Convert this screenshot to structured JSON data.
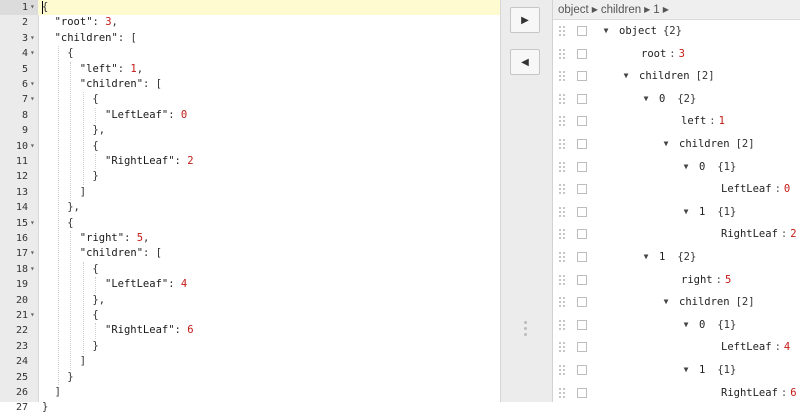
{
  "editor": {
    "lines": [
      {
        "n": "1",
        "fold": true,
        "indent": 0,
        "tokens": [
          {
            "t": "{",
            "c": "pun"
          }
        ]
      },
      {
        "n": "2",
        "fold": false,
        "indent": 1,
        "tokens": [
          {
            "t": "\"root\"",
            "c": "key"
          },
          {
            "t": ": ",
            "c": "pun"
          },
          {
            "t": "3",
            "c": "num"
          },
          {
            "t": ",",
            "c": "pun"
          }
        ]
      },
      {
        "n": "3",
        "fold": true,
        "indent": 1,
        "tokens": [
          {
            "t": "\"children\"",
            "c": "key"
          },
          {
            "t": ": [",
            "c": "pun"
          }
        ]
      },
      {
        "n": "4",
        "fold": true,
        "indent": 2,
        "tokens": [
          {
            "t": "{",
            "c": "pun"
          }
        ]
      },
      {
        "n": "5",
        "fold": false,
        "indent": 3,
        "tokens": [
          {
            "t": "\"left\"",
            "c": "key"
          },
          {
            "t": ": ",
            "c": "pun"
          },
          {
            "t": "1",
            "c": "num"
          },
          {
            "t": ",",
            "c": "pun"
          }
        ]
      },
      {
        "n": "6",
        "fold": true,
        "indent": 3,
        "tokens": [
          {
            "t": "\"children\"",
            "c": "key"
          },
          {
            "t": ": [",
            "c": "pun"
          }
        ]
      },
      {
        "n": "7",
        "fold": true,
        "indent": 4,
        "tokens": [
          {
            "t": "{",
            "c": "pun"
          }
        ]
      },
      {
        "n": "8",
        "fold": false,
        "indent": 5,
        "tokens": [
          {
            "t": "\"LeftLeaf\"",
            "c": "key"
          },
          {
            "t": ": ",
            "c": "pun"
          },
          {
            "t": "0",
            "c": "num"
          }
        ]
      },
      {
        "n": "9",
        "fold": false,
        "indent": 4,
        "tokens": [
          {
            "t": "},",
            "c": "pun"
          }
        ]
      },
      {
        "n": "10",
        "fold": true,
        "indent": 4,
        "tokens": [
          {
            "t": "{",
            "c": "pun"
          }
        ]
      },
      {
        "n": "11",
        "fold": false,
        "indent": 5,
        "tokens": [
          {
            "t": "\"RightLeaf\"",
            "c": "key"
          },
          {
            "t": ": ",
            "c": "pun"
          },
          {
            "t": "2",
            "c": "num"
          }
        ]
      },
      {
        "n": "12",
        "fold": false,
        "indent": 4,
        "tokens": [
          {
            "t": "}",
            "c": "pun"
          }
        ]
      },
      {
        "n": "13",
        "fold": false,
        "indent": 3,
        "tokens": [
          {
            "t": "]",
            "c": "pun"
          }
        ]
      },
      {
        "n": "14",
        "fold": false,
        "indent": 2,
        "tokens": [
          {
            "t": "},",
            "c": "pun"
          }
        ]
      },
      {
        "n": "15",
        "fold": true,
        "indent": 2,
        "tokens": [
          {
            "t": "{",
            "c": "pun"
          }
        ]
      },
      {
        "n": "16",
        "fold": false,
        "indent": 3,
        "tokens": [
          {
            "t": "\"right\"",
            "c": "key"
          },
          {
            "t": ": ",
            "c": "pun"
          },
          {
            "t": "5",
            "c": "num"
          },
          {
            "t": ",",
            "c": "pun"
          }
        ]
      },
      {
        "n": "17",
        "fold": true,
        "indent": 3,
        "tokens": [
          {
            "t": "\"children\"",
            "c": "key"
          },
          {
            "t": ": [",
            "c": "pun"
          }
        ]
      },
      {
        "n": "18",
        "fold": true,
        "indent": 4,
        "tokens": [
          {
            "t": "{",
            "c": "pun"
          }
        ]
      },
      {
        "n": "19",
        "fold": false,
        "indent": 5,
        "tokens": [
          {
            "t": "\"LeftLeaf\"",
            "c": "key"
          },
          {
            "t": ": ",
            "c": "pun"
          },
          {
            "t": "4",
            "c": "num"
          }
        ]
      },
      {
        "n": "20",
        "fold": false,
        "indent": 4,
        "tokens": [
          {
            "t": "},",
            "c": "pun"
          }
        ]
      },
      {
        "n": "21",
        "fold": true,
        "indent": 4,
        "tokens": [
          {
            "t": "{",
            "c": "pun"
          }
        ]
      },
      {
        "n": "22",
        "fold": false,
        "indent": 5,
        "tokens": [
          {
            "t": "\"RightLeaf\"",
            "c": "key"
          },
          {
            "t": ": ",
            "c": "pun"
          },
          {
            "t": "6",
            "c": "num"
          }
        ]
      },
      {
        "n": "23",
        "fold": false,
        "indent": 4,
        "tokens": [
          {
            "t": "}",
            "c": "pun"
          }
        ]
      },
      {
        "n": "24",
        "fold": false,
        "indent": 3,
        "tokens": [
          {
            "t": "]",
            "c": "pun"
          }
        ]
      },
      {
        "n": "25",
        "fold": false,
        "indent": 2,
        "tokens": [
          {
            "t": "}",
            "c": "pun"
          }
        ]
      },
      {
        "n": "26",
        "fold": false,
        "indent": 1,
        "tokens": [
          {
            "t": "]",
            "c": "pun"
          }
        ]
      },
      {
        "n": "27",
        "fold": false,
        "indent": 0,
        "tokens": [
          {
            "t": "}",
            "c": "pun"
          }
        ]
      }
    ],
    "active_line": "1"
  },
  "buttons": {
    "copy_right_icon": "triangle-right-icon",
    "copy_left_icon": "triangle-left-icon",
    "copy_right_glyph": "▶",
    "copy_left_glyph": "◀"
  },
  "breadcrumb": [
    {
      "label": "object"
    },
    {
      "label": "children"
    },
    {
      "label": "1"
    }
  ],
  "breadcrumb_arrow": "▶",
  "tree": [
    {
      "level": 0,
      "expand": true,
      "key": "object",
      "kind": "label",
      "count": "{2}"
    },
    {
      "level": 2,
      "expand": false,
      "key": "root",
      "kind": "field",
      "value": "3"
    },
    {
      "level": 1,
      "expand": true,
      "key": "children",
      "kind": "label",
      "count": "[2]"
    },
    {
      "level": 2,
      "expand": true,
      "key": "0",
      "kind": "index",
      "count": "{2}"
    },
    {
      "level": 4,
      "expand": false,
      "key": "left",
      "kind": "field",
      "value": "1"
    },
    {
      "level": 3,
      "expand": true,
      "key": "children",
      "kind": "label",
      "count": "[2]"
    },
    {
      "level": 4,
      "expand": true,
      "key": "0",
      "kind": "index",
      "count": "{1}"
    },
    {
      "level": 6,
      "expand": false,
      "key": "LeftLeaf",
      "kind": "field",
      "value": "0"
    },
    {
      "level": 4,
      "expand": true,
      "key": "1",
      "kind": "index",
      "count": "{1}"
    },
    {
      "level": 6,
      "expand": false,
      "key": "RightLeaf",
      "kind": "field",
      "value": "2"
    },
    {
      "level": 2,
      "expand": true,
      "key": "1",
      "kind": "index",
      "count": "{2}"
    },
    {
      "level": 4,
      "expand": false,
      "key": "right",
      "kind": "field",
      "value": "5"
    },
    {
      "level": 3,
      "expand": true,
      "key": "children",
      "kind": "label",
      "count": "[2]"
    },
    {
      "level": 4,
      "expand": true,
      "key": "0",
      "kind": "index",
      "count": "{1}"
    },
    {
      "level": 6,
      "expand": false,
      "key": "LeftLeaf",
      "kind": "field",
      "value": "4"
    },
    {
      "level": 4,
      "expand": true,
      "key": "1",
      "kind": "index",
      "count": "{1}"
    },
    {
      "level": 6,
      "expand": false,
      "key": "RightLeaf",
      "kind": "field",
      "value": "6"
    }
  ],
  "colors": {
    "number": "#c41a16",
    "active_line": "#fffbd1",
    "gutter": "#ebebeb"
  }
}
